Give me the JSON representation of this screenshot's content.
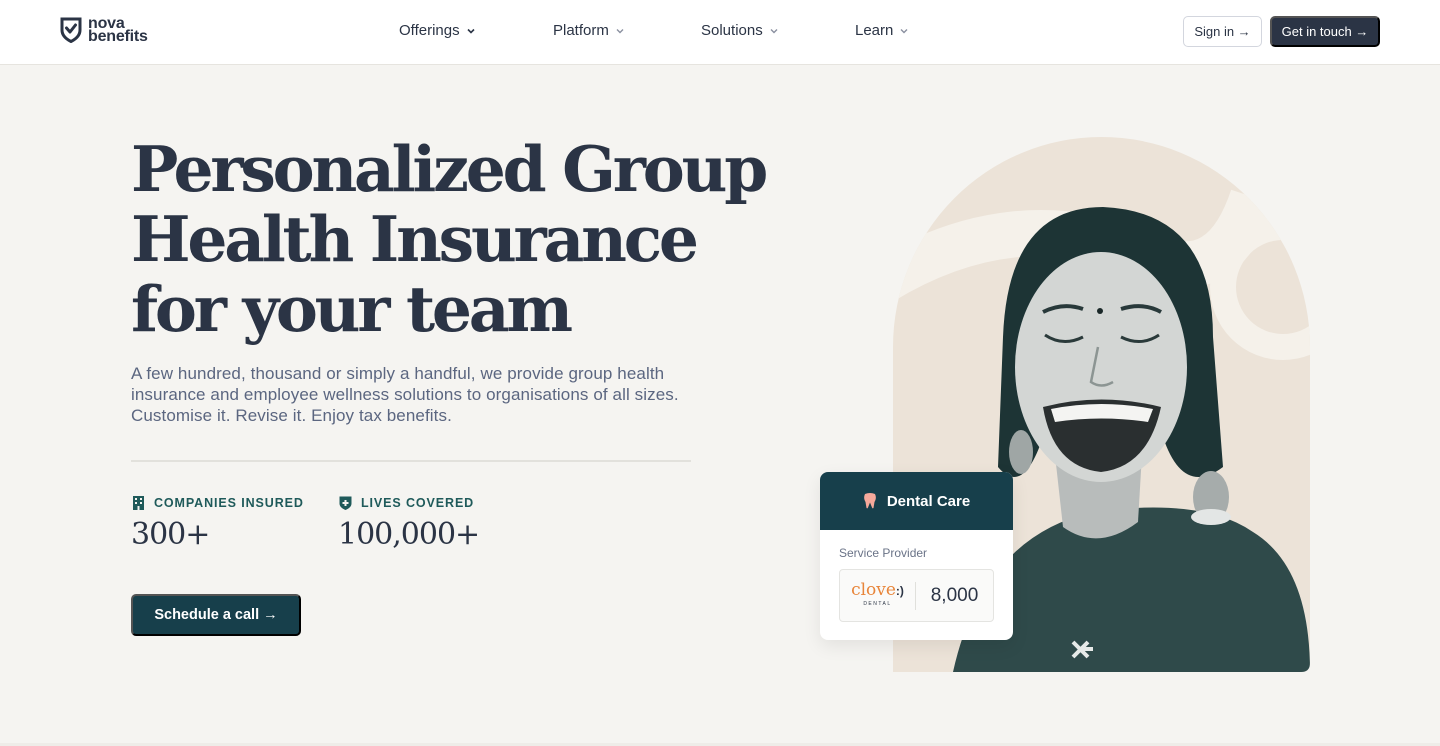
{
  "brand": {
    "name_line1": "nova",
    "name_line2": "benefits"
  },
  "nav": {
    "items": [
      {
        "label": "Offerings"
      },
      {
        "label": "Platform"
      },
      {
        "label": "Solutions"
      },
      {
        "label": "Learn"
      }
    ],
    "sign_in": "Sign in →",
    "contact": "Get in touch →"
  },
  "hero": {
    "headline_line1": "Personalized Group",
    "headline_line2": "Health Insurance",
    "headline_line3": "for your team",
    "subtext": "A few hundred, thousand or simply a handful, we provide group health insurance and employee wellness solutions to organisations of all sizes. Customise it. Revise it. Enjoy tax benefits.",
    "stats": [
      {
        "label": "COMPANIES INSURED",
        "value": "300+"
      },
      {
        "label": "LIVES COVERED",
        "value": "100,000+"
      }
    ],
    "cta": "Schedule a call →"
  },
  "card": {
    "title": "Dental Care",
    "subtitle": "Service Provider",
    "provider_name": "clove",
    "provider_smile": ":)",
    "provider_tagline": "DENTAL",
    "provider_count": "8,000"
  },
  "colors": {
    "primary": "#2b3445",
    "accent": "#173f4b",
    "teal": "#1f5a5a",
    "background": "#f5f4f1",
    "clove_orange": "#e8853a"
  }
}
